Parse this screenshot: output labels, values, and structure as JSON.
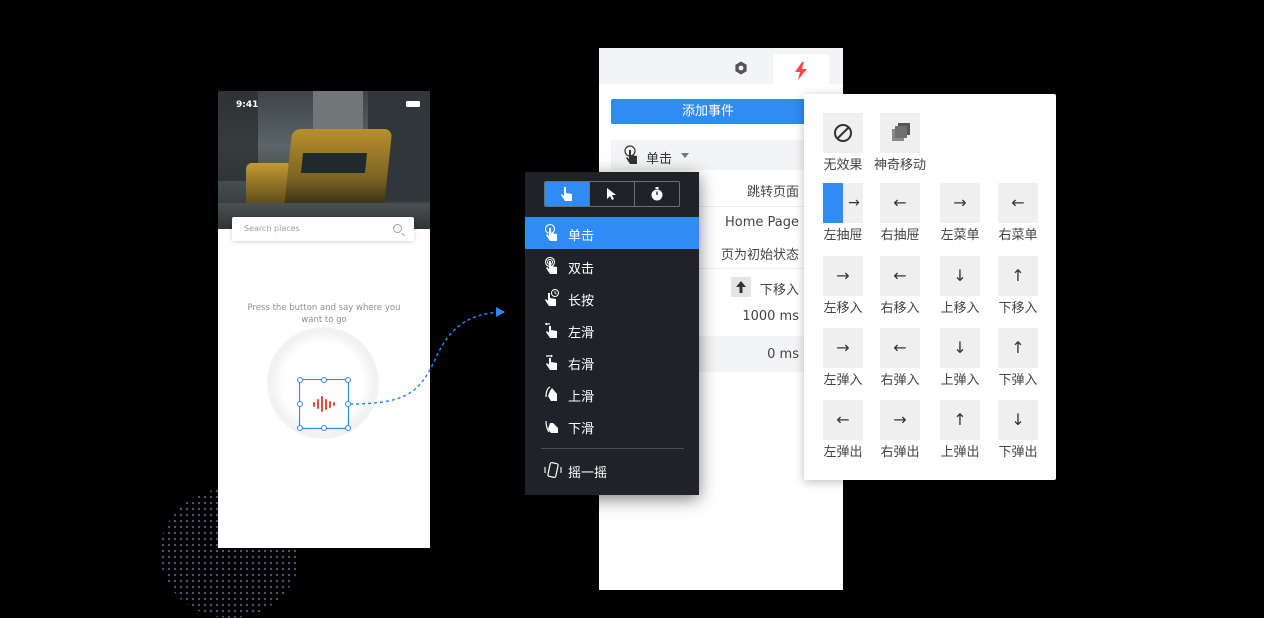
{
  "phone": {
    "status_time": "9:41",
    "search_placeholder": "Search places",
    "prompt_text": "Press the button and say where you want to go",
    "accent_color": "#e4493c"
  },
  "properties_panel": {
    "tabs": [
      {
        "icon": "hexagon-settings-icon",
        "active": false
      },
      {
        "icon": "lightning-bolt-icon",
        "active": true
      }
    ],
    "add_event_label": "添加事件",
    "trigger_label": "单击",
    "action_value": "跳转页面",
    "target_page": "Home Page",
    "reset_option": "页为初始状态",
    "transition_value": "下移入",
    "duration_value": "1000 ms",
    "delay_value": "0 ms"
  },
  "trigger_menu": {
    "segments": [
      "hand-pointer-icon",
      "cursor-icon",
      "stopwatch-icon"
    ],
    "items": [
      {
        "label": "单击",
        "icon": "tap-icon",
        "selected": true
      },
      {
        "label": "双击",
        "icon": "double-tap-icon",
        "selected": false
      },
      {
        "label": "长按",
        "icon": "long-press-icon",
        "selected": false
      },
      {
        "label": "左滑",
        "icon": "swipe-left-icon",
        "selected": false
      },
      {
        "label": "右滑",
        "icon": "swipe-right-icon",
        "selected": false
      },
      {
        "label": "上滑",
        "icon": "swipe-up-icon",
        "selected": false
      },
      {
        "label": "下滑",
        "icon": "swipe-down-icon",
        "selected": false
      },
      {
        "label": "摇一摇",
        "icon": "shake-phone-icon",
        "selected": false
      }
    ]
  },
  "animation_panel": {
    "top": [
      {
        "label": "无效果",
        "icon": "no-effect-icon"
      },
      {
        "label": "神奇移动",
        "icon": "magic-move-icon"
      }
    ],
    "rows": [
      [
        {
          "label": "左抽屉",
          "arrow": "→"
        },
        {
          "label": "右抽屉",
          "arrow": "←"
        },
        {
          "label": "左菜单",
          "arrow": "→"
        },
        {
          "label": "右菜单",
          "arrow": "←"
        }
      ],
      [
        {
          "label": "左移入",
          "arrow": "→"
        },
        {
          "label": "右移入",
          "arrow": "←"
        },
        {
          "label": "上移入",
          "arrow": "↓"
        },
        {
          "label": "下移入",
          "arrow": "↑"
        }
      ],
      [
        {
          "label": "左弹入",
          "arrow": "→"
        },
        {
          "label": "右弹入",
          "arrow": "←"
        },
        {
          "label": "上弹入",
          "arrow": "↓"
        },
        {
          "label": "下弹入",
          "arrow": "↑"
        }
      ],
      [
        {
          "label": "左弹出",
          "arrow": "←"
        },
        {
          "label": "右弹出",
          "arrow": "→"
        },
        {
          "label": "上弹出",
          "arrow": "↑"
        },
        {
          "label": "下弹出",
          "arrow": "↓"
        }
      ]
    ],
    "accent_color": "#2f8cf5"
  }
}
